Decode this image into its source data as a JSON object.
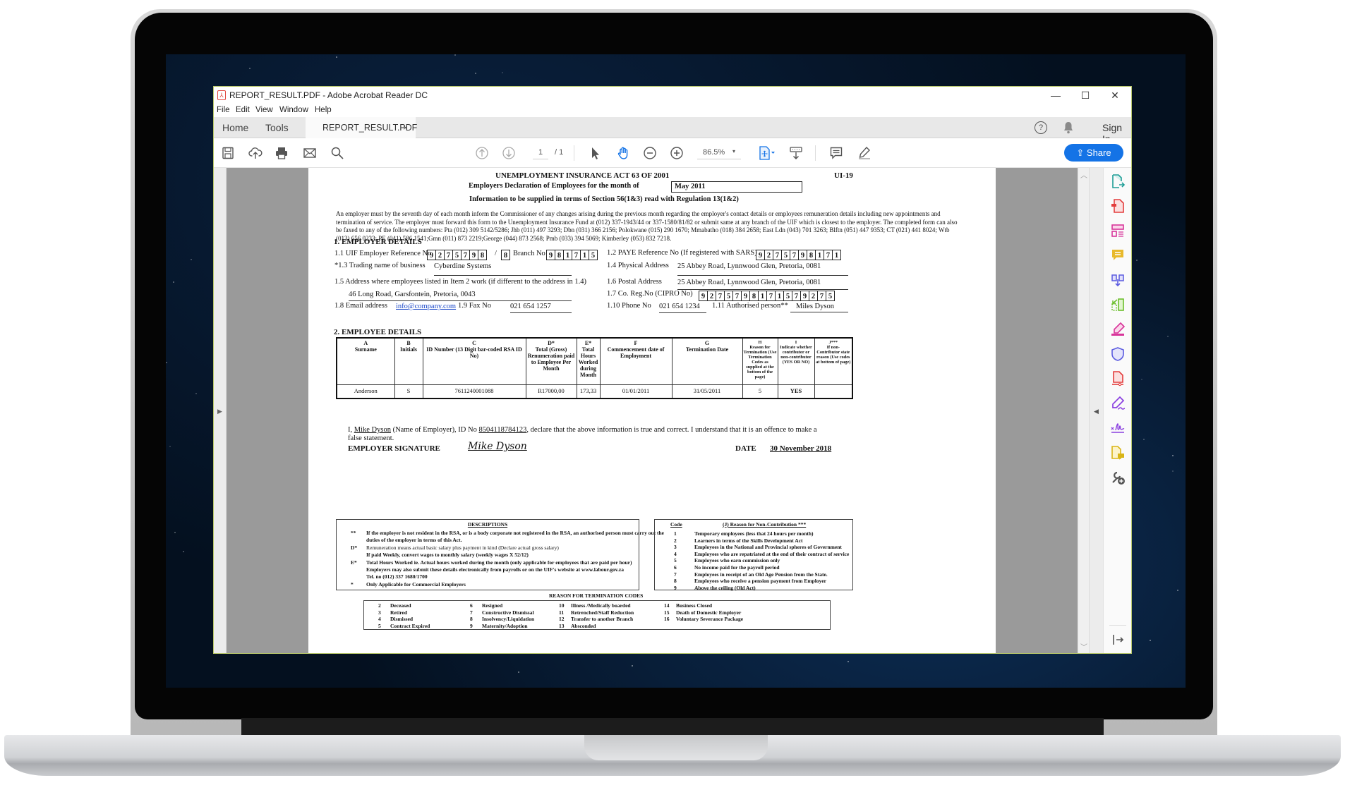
{
  "window": {
    "title": "REPORT_RESULT.PDF - Adobe Acrobat Reader DC",
    "controls": {
      "minimize": "—",
      "maximize": "☐",
      "close": "✕"
    }
  },
  "menu": [
    "File",
    "Edit",
    "View",
    "Window",
    "Help"
  ],
  "tabs": {
    "home": "Home",
    "tools": "Tools",
    "document": "REPORT_RESULT.PDF",
    "close": "×"
  },
  "header_right": {
    "help": "?",
    "sign_in": "Sign In"
  },
  "toolbar": {
    "page_current": "1",
    "page_total": "/ 1",
    "zoom": "86.5%",
    "zoom_caret": "▾",
    "share_label": "Share",
    "icons": [
      "save-icon",
      "upload-icon",
      "print-icon",
      "mail-icon",
      "search-icon",
      "prev-page-icon",
      "next-page-icon",
      "select-icon",
      "hand-icon",
      "zoom-out-icon",
      "zoom-in-icon",
      "page-tools-icon",
      "scroll-mode-icon",
      "comment-icon",
      "highlight-icon"
    ]
  },
  "right_pane_tools": [
    "export-pdf",
    "create-pdf",
    "edit-pdf",
    "comment",
    "combine-files",
    "organize-pages",
    "redact",
    "protect",
    "compress-pdf",
    "fill-sign",
    "send-for-signature",
    "send-for-comments",
    "more-tools",
    "collapse-pane"
  ],
  "form": {
    "act_title": "UNEMPLOYMENT INSURANCE ACT 63 OF 2001",
    "form_code": "UI-19",
    "declaration_title": "Employers Declaration of Employees for the month of",
    "month": "May 2011",
    "info_title": "Information to be supplied in terms of Section 56(1&3) read with Regulation 13(1&2)",
    "intro": "An employer must by the seventh day of each month inform the Commissioner of any changes arising during the previous month regarding the employer's contact details or employees remuneration details including new appointments and termination of service.  The employer must forward this form to the Unemployment Insurance Fund at (012) 337-1943/44 or 337-1580/81/82 or submit same at any branch of the UIF which is closest to the employer. The completed form can also be faxed to any of the following numbers: Pta (012) 309 5142/5286; Jhb (011) 497 3293; Dbn (031) 366 2156; Polokwane (015) 290 1670; Mmabatho (018) 384 2658; East Ldn (043) 701 3263; Blftn (051) 447 9353; CT (021) 441 8024; Wtb (013) 656 0233; PE (041) 586 1541;Gmn (011) 873 2219;George (044) 873 2568; Pmb (033) 394 5069; Kimberley (053) 832 7218.",
    "section1": "1. EMPLOYER DETAILS",
    "uif_ref_label": "1.1  UIF Employer Reference No",
    "uif_ref_digits": [
      "9",
      "2",
      "7",
      "5",
      "7",
      "9",
      "8"
    ],
    "uif_ref_slash": "/",
    "uif_ref_suffix": "8",
    "branch_label": "Branch No",
    "branch_digits": [
      "9",
      "8",
      "1",
      "7",
      "1",
      "5"
    ],
    "paye_label": "1.2  PAYE Reference No (If registered with SARS)",
    "paye_digits": [
      "9",
      "2",
      "7",
      "5",
      "7",
      "9",
      "8",
      "1",
      "7",
      "1"
    ],
    "trading_label": "*1.3  Trading name of business",
    "trading_value": "Cyberdine Systems",
    "physical_label": "1.4  Physical Address",
    "physical_value": "25 Abbey Road, Lynnwood Glen, Pretoria, 0081",
    "work_address_label": "1.5  Address where employees listed in Item 2 work (if different to the address in 1.4)",
    "work_address_value": "46 Long Road, Garsfontein, Pretoria, 0043",
    "postal_label": "1.6  Postal Address",
    "postal_value": "25 Abbey Road, Lynnwood Glen, Pretoria, 0081",
    "coreg_label": "1.7  Co. Reg.No (CIPRO No)",
    "coreg_digits": [
      "9",
      "2",
      "7",
      "5",
      "7",
      "9",
      "8",
      "1",
      "7",
      "1",
      "5",
      "7",
      "9",
      "2",
      "7",
      "5"
    ],
    "email_label": "1.8  Email address",
    "email_value": "info@company.com",
    "fax_label": "1.9  Fax No",
    "fax_value": "021 654 1257",
    "phone_label": "1.10  Phone No",
    "phone_value": "021 654 1234",
    "auth_label": "1.11  Authorised person**",
    "auth_value": "Miles Dyson",
    "section2": "2. EMPLOYEE DETAILS",
    "columns": [
      {
        "key": "A",
        "label": "Surname"
      },
      {
        "key": "B",
        "label": "Initials"
      },
      {
        "key": "C",
        "label": "ID Number (13 Digit bar-coded RSA ID No)"
      },
      {
        "key": "D*",
        "label": "Total (Gross) Renumeration paid to Employee Per Month"
      },
      {
        "key": "E*",
        "label": "Total Hours Worked during Month"
      },
      {
        "key": "F",
        "label": "Commencement date of Employment"
      },
      {
        "key": "G",
        "label": "Termination Date"
      },
      {
        "key": "H",
        "label": "Reason for Termination (Use Termination Codes as supplied at the bottom of the page)"
      },
      {
        "key": "I",
        "label": "Indicate whether contributor or non-contributor (YES OR NO)"
      },
      {
        "key": "J***",
        "label": "If non-Contributor state reason (Use codes at bottom of page)"
      }
    ],
    "rows": [
      [
        "Anderson",
        "S",
        "7611240001088",
        "R17000,00",
        "173,33",
        "01/01/2011",
        "31/05/2011",
        "5",
        "YES",
        ""
      ]
    ],
    "declaration": {
      "prefix": "I, ",
      "name": "Mike Dyson",
      "mid": " (Name of Employer), ID No ",
      "id_no": "8504118784123",
      "suffix": ", declare that the above information is true and correct.  I understand that it is an offence to make a",
      "line2": "false statement.",
      "signature_label": "EMPLOYER SIGNATURE",
      "signature": "Mike Dyson",
      "date_label": "DATE",
      "date_value": "30 November 2018"
    },
    "descriptions": {
      "title": "DESCRIPTIONS",
      "items": [
        {
          "key": "**",
          "lines": [
            "If the employer is not resident in the RSA, or is a body corporate not registered in the RSA, an authorised person must carry out the",
            "duties of the employer in terms of this Act."
          ]
        },
        {
          "key": "D*",
          "lines": [
            "Remuneration means actual basic salary plus payment in kind (Declare actual gross salary)",
            "If paid Weekly, convert wages to monthly salary  (weekly wages X 52/12)"
          ]
        },
        {
          "key": "E*",
          "lines": [
            "Total Hours Worked ie.  Actual hours worked during the month (only applicable for employees that are paid per hour)",
            "Employers may also submit these details electronically from payrolls or on the UIF's website at www.labour.gov.za",
            "Tel. no (012) 337 1680/1700"
          ]
        },
        {
          "key": "*",
          "lines": [
            "Only Applicable for Commercial Employers"
          ]
        }
      ]
    },
    "non_contribution": {
      "code_header": "Code",
      "title": "(J) Reason for Non-Contribution ***",
      "items": [
        {
          "code": "1",
          "text": "Temporary employees (less that 24 hours per month)"
        },
        {
          "code": "2",
          "text": "Learners in terms of the Skills Development Act"
        },
        {
          "code": "3",
          "text": "Employees in the National and Provincial spheres of Government"
        },
        {
          "code": "4",
          "text": "Employees who are repatriated at the end of their contract of service"
        },
        {
          "code": "5",
          "text": "Employees who earn commission only"
        },
        {
          "code": "6",
          "text": "No income paid for the payroll period"
        },
        {
          "code": "7",
          "text": "Employees in receipt of an Old Age Pension from the State."
        },
        {
          "code": "8",
          "text": "Employees who receive a pension payment from Employer"
        },
        {
          "code": "9",
          "text": "Above the ceiling (Old Act)"
        }
      ]
    },
    "termination": {
      "title": "REASON FOR TERMINATION CODES",
      "columns": [
        [
          {
            "code": "2",
            "text": "Deceased"
          },
          {
            "code": "3",
            "text": "Retired"
          },
          {
            "code": "4",
            "text": "Dismissed"
          },
          {
            "code": "5",
            "text": "Contract Expired"
          }
        ],
        [
          {
            "code": "6",
            "text": "Resigned"
          },
          {
            "code": "7",
            "text": "Constructive Dismissal"
          },
          {
            "code": "8",
            "text": "Insolvency/Liquidation"
          },
          {
            "code": "9",
            "text": "Maternity/Adoption"
          }
        ],
        [
          {
            "code": "10",
            "text": "Illness /Medically boarded"
          },
          {
            "code": "11",
            "text": "Retrenched/Staff Reduction"
          },
          {
            "code": "12",
            "text": "Transfer to another Branch"
          },
          {
            "code": "13",
            "text": "Absconded"
          }
        ],
        [
          {
            "code": "14",
            "text": "Business Closed"
          },
          {
            "code": "15",
            "text": "Death of Domestic Employer"
          },
          {
            "code": "16",
            "text": "Voluntary Severance Package"
          }
        ]
      ]
    }
  },
  "colors": {
    "accent": "#1473e6",
    "window_border": "#b9c86b",
    "doc_background": "#9a9a9a"
  }
}
